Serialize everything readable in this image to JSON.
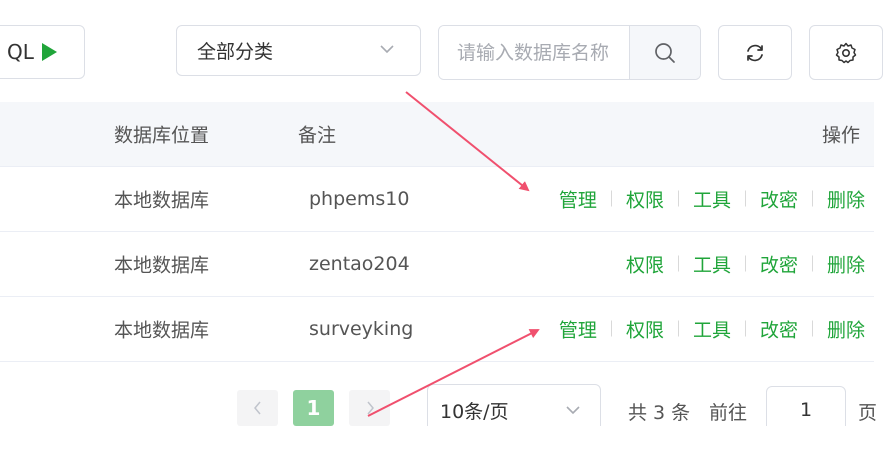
{
  "toolbar": {
    "sql_button_label": "QL",
    "category_select": "全部分类",
    "search_placeholder": "请输入数据库名称"
  },
  "table": {
    "headers": {
      "location": "数据库位置",
      "remark": "备注",
      "actions": "操作"
    },
    "rows": [
      {
        "location": "本地数据库",
        "remark": "phpems10",
        "actions": [
          "管理",
          "权限",
          "工具",
          "改密",
          "删除"
        ]
      },
      {
        "location": "本地数据库",
        "remark": "zentao204",
        "actions": [
          "权限",
          "工具",
          "改密",
          "删除"
        ]
      },
      {
        "location": "本地数据库",
        "remark": "surveyking",
        "actions": [
          "管理",
          "权限",
          "工具",
          "改密",
          "删除"
        ]
      }
    ]
  },
  "pagination": {
    "current_page": "1",
    "page_size": "10条/页",
    "total": "共 3 条",
    "goto_label": "前往",
    "goto_value": "1",
    "page_suffix": "页"
  },
  "colors": {
    "accent": "#20a53a",
    "arrow": "#f0506e",
    "active_page": "#8fd19e"
  },
  "icons": [
    "play-icon",
    "chevron-down-icon",
    "search-icon",
    "refresh-icon",
    "gear-icon",
    "chevron-left-icon",
    "chevron-right-icon"
  ]
}
